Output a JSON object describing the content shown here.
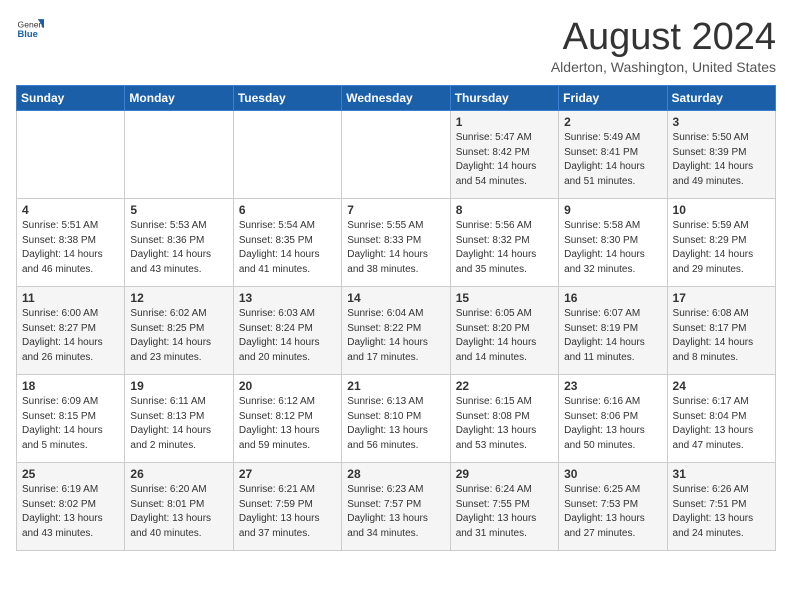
{
  "header": {
    "logo": {
      "general": "General",
      "blue": "Blue"
    },
    "month_year": "August 2024",
    "location": "Alderton, Washington, United States"
  },
  "weekdays": [
    "Sunday",
    "Monday",
    "Tuesday",
    "Wednesday",
    "Thursday",
    "Friday",
    "Saturday"
  ],
  "weeks": [
    [
      {
        "day": "",
        "info": ""
      },
      {
        "day": "",
        "info": ""
      },
      {
        "day": "",
        "info": ""
      },
      {
        "day": "",
        "info": ""
      },
      {
        "day": "1",
        "info": "Sunrise: 5:47 AM\nSunset: 8:42 PM\nDaylight: 14 hours\nand 54 minutes."
      },
      {
        "day": "2",
        "info": "Sunrise: 5:49 AM\nSunset: 8:41 PM\nDaylight: 14 hours\nand 51 minutes."
      },
      {
        "day": "3",
        "info": "Sunrise: 5:50 AM\nSunset: 8:39 PM\nDaylight: 14 hours\nand 49 minutes."
      }
    ],
    [
      {
        "day": "4",
        "info": "Sunrise: 5:51 AM\nSunset: 8:38 PM\nDaylight: 14 hours\nand 46 minutes."
      },
      {
        "day": "5",
        "info": "Sunrise: 5:53 AM\nSunset: 8:36 PM\nDaylight: 14 hours\nand 43 minutes."
      },
      {
        "day": "6",
        "info": "Sunrise: 5:54 AM\nSunset: 8:35 PM\nDaylight: 14 hours\nand 41 minutes."
      },
      {
        "day": "7",
        "info": "Sunrise: 5:55 AM\nSunset: 8:33 PM\nDaylight: 14 hours\nand 38 minutes."
      },
      {
        "day": "8",
        "info": "Sunrise: 5:56 AM\nSunset: 8:32 PM\nDaylight: 14 hours\nand 35 minutes."
      },
      {
        "day": "9",
        "info": "Sunrise: 5:58 AM\nSunset: 8:30 PM\nDaylight: 14 hours\nand 32 minutes."
      },
      {
        "day": "10",
        "info": "Sunrise: 5:59 AM\nSunset: 8:29 PM\nDaylight: 14 hours\nand 29 minutes."
      }
    ],
    [
      {
        "day": "11",
        "info": "Sunrise: 6:00 AM\nSunset: 8:27 PM\nDaylight: 14 hours\nand 26 minutes."
      },
      {
        "day": "12",
        "info": "Sunrise: 6:02 AM\nSunset: 8:25 PM\nDaylight: 14 hours\nand 23 minutes."
      },
      {
        "day": "13",
        "info": "Sunrise: 6:03 AM\nSunset: 8:24 PM\nDaylight: 14 hours\nand 20 minutes."
      },
      {
        "day": "14",
        "info": "Sunrise: 6:04 AM\nSunset: 8:22 PM\nDaylight: 14 hours\nand 17 minutes."
      },
      {
        "day": "15",
        "info": "Sunrise: 6:05 AM\nSunset: 8:20 PM\nDaylight: 14 hours\nand 14 minutes."
      },
      {
        "day": "16",
        "info": "Sunrise: 6:07 AM\nSunset: 8:19 PM\nDaylight: 14 hours\nand 11 minutes."
      },
      {
        "day": "17",
        "info": "Sunrise: 6:08 AM\nSunset: 8:17 PM\nDaylight: 14 hours\nand 8 minutes."
      }
    ],
    [
      {
        "day": "18",
        "info": "Sunrise: 6:09 AM\nSunset: 8:15 PM\nDaylight: 14 hours\nand 5 minutes."
      },
      {
        "day": "19",
        "info": "Sunrise: 6:11 AM\nSunset: 8:13 PM\nDaylight: 14 hours\nand 2 minutes."
      },
      {
        "day": "20",
        "info": "Sunrise: 6:12 AM\nSunset: 8:12 PM\nDaylight: 13 hours\nand 59 minutes."
      },
      {
        "day": "21",
        "info": "Sunrise: 6:13 AM\nSunset: 8:10 PM\nDaylight: 13 hours\nand 56 minutes."
      },
      {
        "day": "22",
        "info": "Sunrise: 6:15 AM\nSunset: 8:08 PM\nDaylight: 13 hours\nand 53 minutes."
      },
      {
        "day": "23",
        "info": "Sunrise: 6:16 AM\nSunset: 8:06 PM\nDaylight: 13 hours\nand 50 minutes."
      },
      {
        "day": "24",
        "info": "Sunrise: 6:17 AM\nSunset: 8:04 PM\nDaylight: 13 hours\nand 47 minutes."
      }
    ],
    [
      {
        "day": "25",
        "info": "Sunrise: 6:19 AM\nSunset: 8:02 PM\nDaylight: 13 hours\nand 43 minutes."
      },
      {
        "day": "26",
        "info": "Sunrise: 6:20 AM\nSunset: 8:01 PM\nDaylight: 13 hours\nand 40 minutes."
      },
      {
        "day": "27",
        "info": "Sunrise: 6:21 AM\nSunset: 7:59 PM\nDaylight: 13 hours\nand 37 minutes."
      },
      {
        "day": "28",
        "info": "Sunrise: 6:23 AM\nSunset: 7:57 PM\nDaylight: 13 hours\nand 34 minutes."
      },
      {
        "day": "29",
        "info": "Sunrise: 6:24 AM\nSunset: 7:55 PM\nDaylight: 13 hours\nand 31 minutes."
      },
      {
        "day": "30",
        "info": "Sunrise: 6:25 AM\nSunset: 7:53 PM\nDaylight: 13 hours\nand 27 minutes."
      },
      {
        "day": "31",
        "info": "Sunrise: 6:26 AM\nSunset: 7:51 PM\nDaylight: 13 hours\nand 24 minutes."
      }
    ]
  ]
}
